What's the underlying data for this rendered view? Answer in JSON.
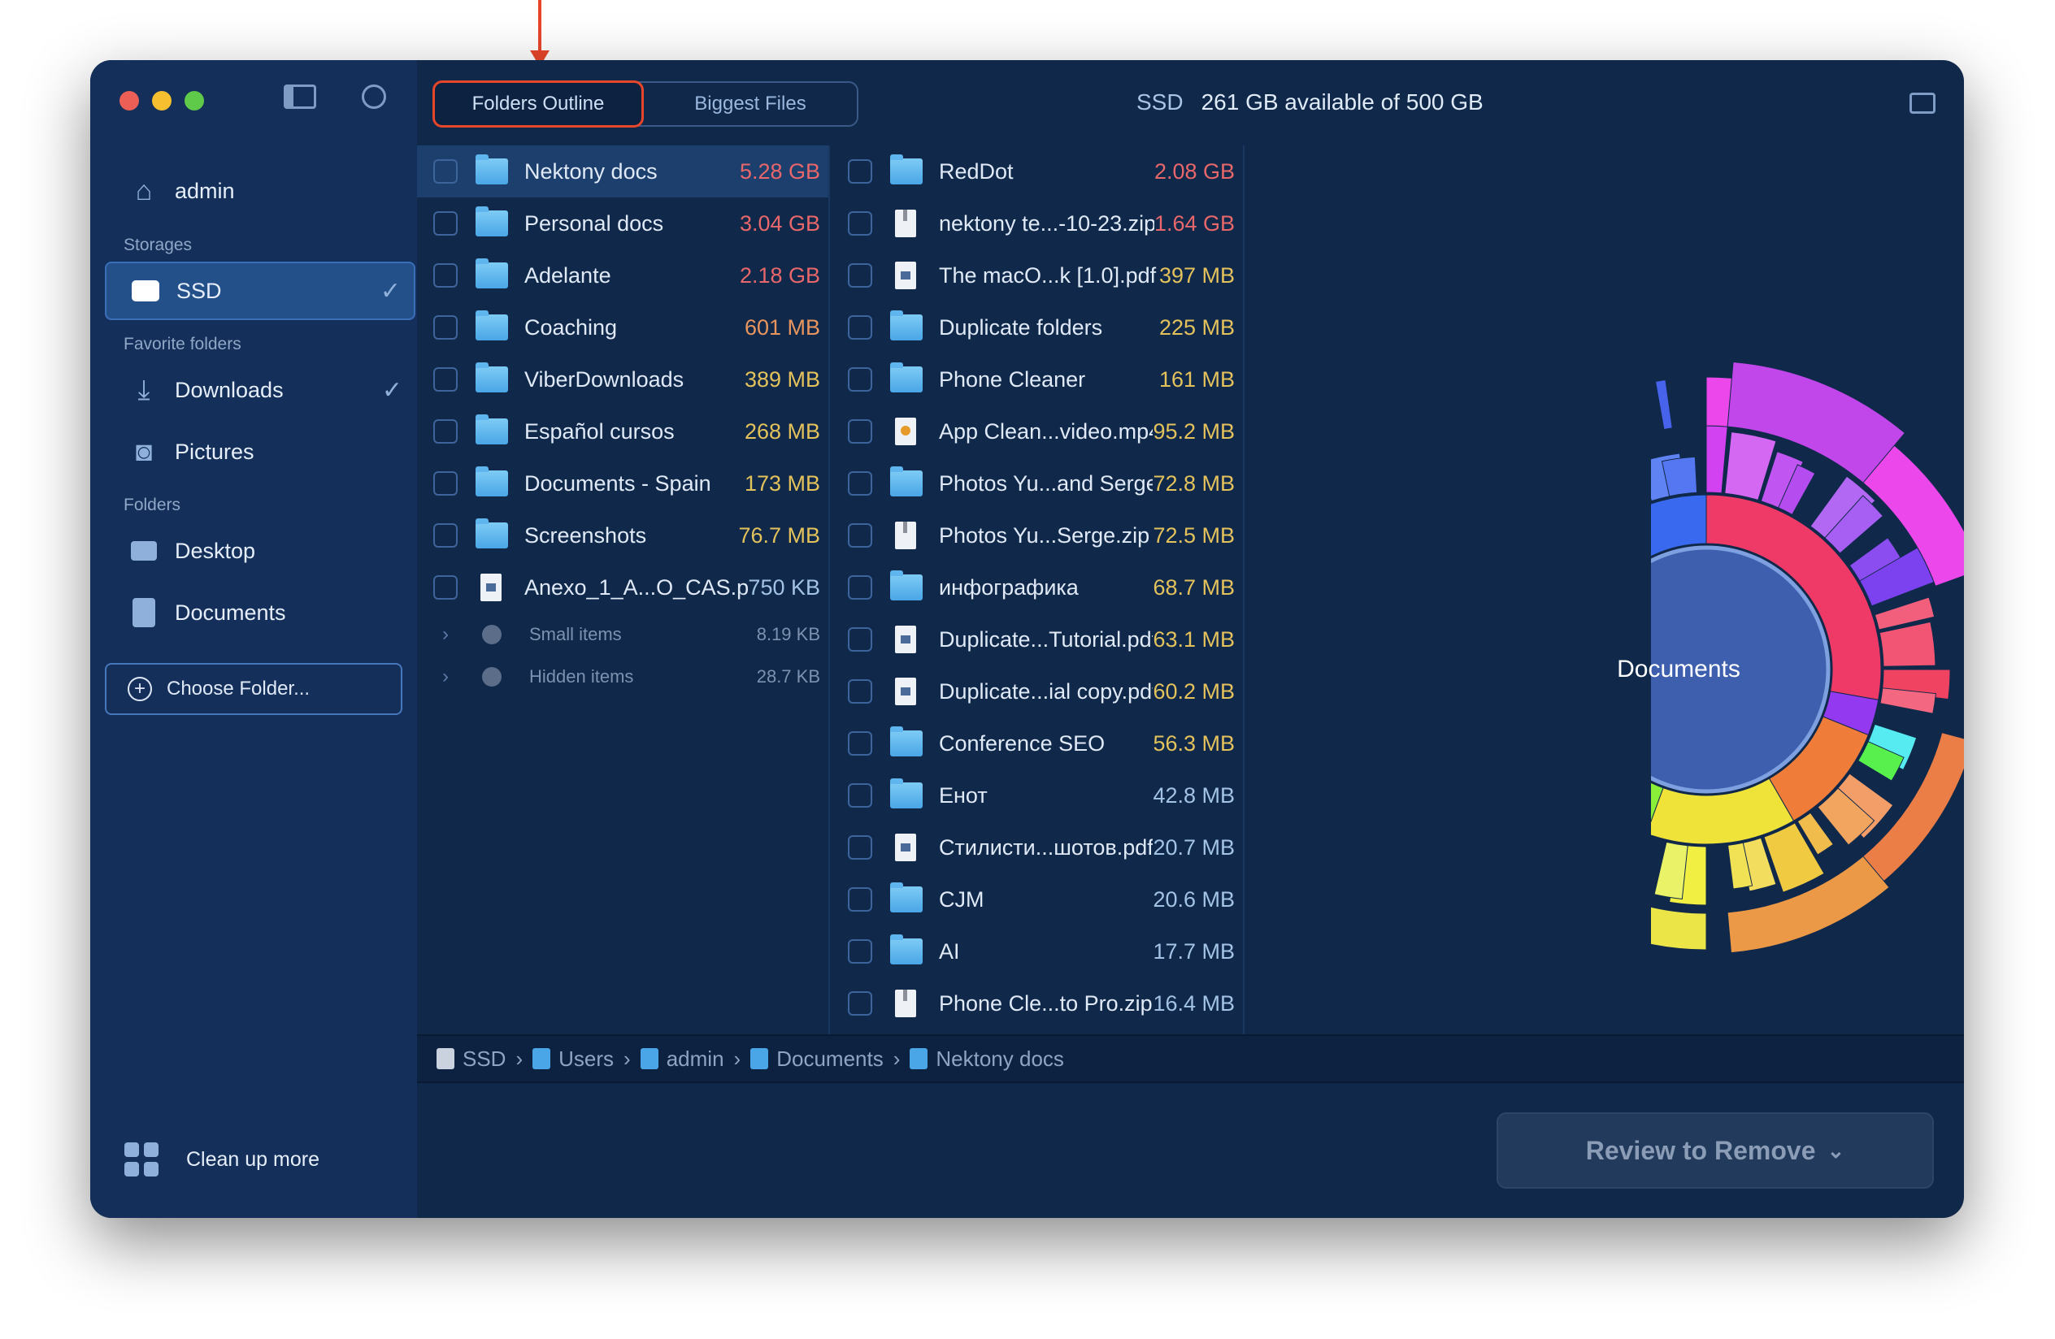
{
  "annotation_color": "#e8462b",
  "window": {
    "traffic_lights": [
      "#ec5f57",
      "#f5bf2f",
      "#5fc94a"
    ],
    "toolbar_icons": [
      "sidebar-toggle-icon",
      "clock-back-icon"
    ]
  },
  "sidebar": {
    "user": {
      "label": "admin",
      "icon": "home-icon"
    },
    "sections": {
      "storages": "Storages",
      "favorites": "Favorite folders",
      "folders": "Folders"
    },
    "storages": [
      {
        "label": "SSD",
        "icon": "drive-icon",
        "checked": true,
        "selected": true
      }
    ],
    "favorites": [
      {
        "label": "Downloads",
        "icon": "download-icon",
        "checked": true
      },
      {
        "label": "Pictures",
        "icon": "camera-icon",
        "checked": false
      }
    ],
    "folders": [
      {
        "label": "Desktop",
        "icon": "desktop-icon"
      },
      {
        "label": "Documents",
        "icon": "document-icon"
      }
    ],
    "choose_folder": "Choose Folder...",
    "cleanup": "Clean up more"
  },
  "header": {
    "tabs": [
      {
        "label": "Folders Outline",
        "active": true
      },
      {
        "label": "Biggest Files",
        "active": false
      }
    ],
    "disk": "SSD",
    "availability": "261 GB available of 500 GB",
    "icons": [
      "feedback-icon",
      "help-icon"
    ]
  },
  "colors": {
    "red": "#e8676a",
    "orange": "#e8955e",
    "yellow": "#e3c25c",
    "blue": "#a3c3e6"
  },
  "column1": [
    {
      "name": "Nektony docs",
      "size": "5.28 GB",
      "type": "folder",
      "color": "red",
      "selected": true
    },
    {
      "name": "Personal docs",
      "size": "3.04 GB",
      "type": "folder",
      "color": "red"
    },
    {
      "name": "Adelante",
      "size": "2.18 GB",
      "type": "folder",
      "color": "red"
    },
    {
      "name": "Coaching",
      "size": "601 MB",
      "type": "folder",
      "color": "orange"
    },
    {
      "name": "ViberDownloads",
      "size": "389 MB",
      "type": "folder",
      "color": "yellow"
    },
    {
      "name": "Español cursos",
      "size": "268 MB",
      "type": "folder",
      "color": "yellow"
    },
    {
      "name": "Documents - Spain",
      "size": "173 MB",
      "type": "folder",
      "color": "yellow"
    },
    {
      "name": "Screenshots",
      "size": "76.7 MB",
      "type": "folder",
      "color": "yellow"
    },
    {
      "name": "Anexo_1_A...O_CAS.pdf",
      "size": "750 KB",
      "type": "pdf",
      "color": "blue"
    }
  ],
  "column1_minor": [
    {
      "name": "Small items",
      "size": "8.19 KB"
    },
    {
      "name": "Hidden items",
      "size": "28.7 KB"
    }
  ],
  "column2": [
    {
      "name": "RedDot",
      "size": "2.08 GB",
      "type": "folder",
      "color": "red"
    },
    {
      "name": "nektony te...-10-23.zip",
      "size": "1.64 GB",
      "type": "zip",
      "color": "red"
    },
    {
      "name": "The macO...k [1.0].pdf",
      "size": "397 MB",
      "type": "pdf",
      "color": "yellow"
    },
    {
      "name": "Duplicate folders",
      "size": "225 MB",
      "type": "folder",
      "color": "yellow"
    },
    {
      "name": "Phone Cleaner",
      "size": "161 MB",
      "type": "folder",
      "color": "yellow"
    },
    {
      "name": "App Clean...video.mp4",
      "size": "95.2 MB",
      "type": "video",
      "color": "yellow"
    },
    {
      "name": "Photos Yu...and Serge",
      "size": "72.8 MB",
      "type": "folder",
      "color": "yellow"
    },
    {
      "name": "Photos Yu...Serge.zip",
      "size": "72.5 MB",
      "type": "zip",
      "color": "yellow"
    },
    {
      "name": "инфографика",
      "size": "68.7 MB",
      "type": "folder",
      "color": "yellow"
    },
    {
      "name": "Duplicate...Tutorial.pdf",
      "size": "63.1 MB",
      "type": "pdf",
      "color": "yellow"
    },
    {
      "name": "Duplicate...ial copy.pdf",
      "size": "60.2 MB",
      "type": "pdf",
      "color": "yellow"
    },
    {
      "name": "Conference SEO",
      "size": "56.3 MB",
      "type": "folder",
      "color": "yellow"
    },
    {
      "name": "Енот",
      "size": "42.8 MB",
      "type": "folder",
      "color": "blue"
    },
    {
      "name": "Стилисти...шотов.pdf",
      "size": "20.7 MB",
      "type": "pdf",
      "color": "blue"
    },
    {
      "name": "CJM",
      "size": "20.6 MB",
      "type": "folder",
      "color": "blue"
    },
    {
      "name": "AI",
      "size": "17.7 MB",
      "type": "folder",
      "color": "blue"
    },
    {
      "name": "Phone Cle...to Pro.zip",
      "size": "16.4 MB",
      "type": "zip",
      "color": "blue"
    }
  ],
  "chart": {
    "center_label": "Documents",
    "inner_color": "#3d5fae"
  },
  "breadcrumb": [
    "SSD",
    "Users",
    "admin",
    "Documents",
    "Nektony docs"
  ],
  "review_button": "Review to Remove"
}
